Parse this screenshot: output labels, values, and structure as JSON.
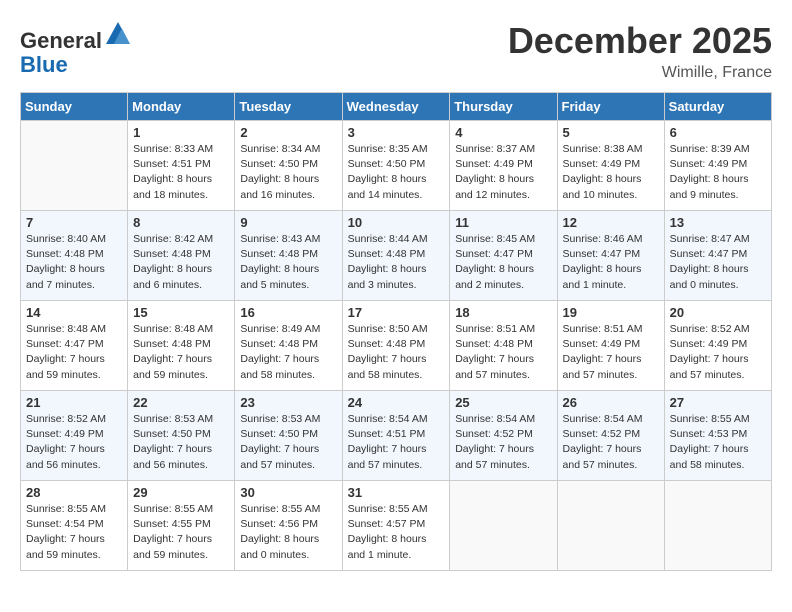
{
  "header": {
    "logo_general": "General",
    "logo_blue": "Blue",
    "month": "December 2025",
    "location": "Wimille, France"
  },
  "days_of_week": [
    "Sunday",
    "Monday",
    "Tuesday",
    "Wednesday",
    "Thursday",
    "Friday",
    "Saturday"
  ],
  "weeks": [
    [
      {
        "day": "",
        "info": ""
      },
      {
        "day": "1",
        "info": "Sunrise: 8:33 AM\nSunset: 4:51 PM\nDaylight: 8 hours\nand 18 minutes."
      },
      {
        "day": "2",
        "info": "Sunrise: 8:34 AM\nSunset: 4:50 PM\nDaylight: 8 hours\nand 16 minutes."
      },
      {
        "day": "3",
        "info": "Sunrise: 8:35 AM\nSunset: 4:50 PM\nDaylight: 8 hours\nand 14 minutes."
      },
      {
        "day": "4",
        "info": "Sunrise: 8:37 AM\nSunset: 4:49 PM\nDaylight: 8 hours\nand 12 minutes."
      },
      {
        "day": "5",
        "info": "Sunrise: 8:38 AM\nSunset: 4:49 PM\nDaylight: 8 hours\nand 10 minutes."
      },
      {
        "day": "6",
        "info": "Sunrise: 8:39 AM\nSunset: 4:49 PM\nDaylight: 8 hours\nand 9 minutes."
      }
    ],
    [
      {
        "day": "7",
        "info": "Sunrise: 8:40 AM\nSunset: 4:48 PM\nDaylight: 8 hours\nand 7 minutes."
      },
      {
        "day": "8",
        "info": "Sunrise: 8:42 AM\nSunset: 4:48 PM\nDaylight: 8 hours\nand 6 minutes."
      },
      {
        "day": "9",
        "info": "Sunrise: 8:43 AM\nSunset: 4:48 PM\nDaylight: 8 hours\nand 5 minutes."
      },
      {
        "day": "10",
        "info": "Sunrise: 8:44 AM\nSunset: 4:48 PM\nDaylight: 8 hours\nand 3 minutes."
      },
      {
        "day": "11",
        "info": "Sunrise: 8:45 AM\nSunset: 4:47 PM\nDaylight: 8 hours\nand 2 minutes."
      },
      {
        "day": "12",
        "info": "Sunrise: 8:46 AM\nSunset: 4:47 PM\nDaylight: 8 hours\nand 1 minute."
      },
      {
        "day": "13",
        "info": "Sunrise: 8:47 AM\nSunset: 4:47 PM\nDaylight: 8 hours\nand 0 minutes."
      }
    ],
    [
      {
        "day": "14",
        "info": "Sunrise: 8:48 AM\nSunset: 4:47 PM\nDaylight: 7 hours\nand 59 minutes."
      },
      {
        "day": "15",
        "info": "Sunrise: 8:48 AM\nSunset: 4:48 PM\nDaylight: 7 hours\nand 59 minutes."
      },
      {
        "day": "16",
        "info": "Sunrise: 8:49 AM\nSunset: 4:48 PM\nDaylight: 7 hours\nand 58 minutes."
      },
      {
        "day": "17",
        "info": "Sunrise: 8:50 AM\nSunset: 4:48 PM\nDaylight: 7 hours\nand 58 minutes."
      },
      {
        "day": "18",
        "info": "Sunrise: 8:51 AM\nSunset: 4:48 PM\nDaylight: 7 hours\nand 57 minutes."
      },
      {
        "day": "19",
        "info": "Sunrise: 8:51 AM\nSunset: 4:49 PM\nDaylight: 7 hours\nand 57 minutes."
      },
      {
        "day": "20",
        "info": "Sunrise: 8:52 AM\nSunset: 4:49 PM\nDaylight: 7 hours\nand 57 minutes."
      }
    ],
    [
      {
        "day": "21",
        "info": "Sunrise: 8:52 AM\nSunset: 4:49 PM\nDaylight: 7 hours\nand 56 minutes."
      },
      {
        "day": "22",
        "info": "Sunrise: 8:53 AM\nSunset: 4:50 PM\nDaylight: 7 hours\nand 56 minutes."
      },
      {
        "day": "23",
        "info": "Sunrise: 8:53 AM\nSunset: 4:50 PM\nDaylight: 7 hours\nand 57 minutes."
      },
      {
        "day": "24",
        "info": "Sunrise: 8:54 AM\nSunset: 4:51 PM\nDaylight: 7 hours\nand 57 minutes."
      },
      {
        "day": "25",
        "info": "Sunrise: 8:54 AM\nSunset: 4:52 PM\nDaylight: 7 hours\nand 57 minutes."
      },
      {
        "day": "26",
        "info": "Sunrise: 8:54 AM\nSunset: 4:52 PM\nDaylight: 7 hours\nand 57 minutes."
      },
      {
        "day": "27",
        "info": "Sunrise: 8:55 AM\nSunset: 4:53 PM\nDaylight: 7 hours\nand 58 minutes."
      }
    ],
    [
      {
        "day": "28",
        "info": "Sunrise: 8:55 AM\nSunset: 4:54 PM\nDaylight: 7 hours\nand 59 minutes."
      },
      {
        "day": "29",
        "info": "Sunrise: 8:55 AM\nSunset: 4:55 PM\nDaylight: 7 hours\nand 59 minutes."
      },
      {
        "day": "30",
        "info": "Sunrise: 8:55 AM\nSunset: 4:56 PM\nDaylight: 8 hours\nand 0 minutes."
      },
      {
        "day": "31",
        "info": "Sunrise: 8:55 AM\nSunset: 4:57 PM\nDaylight: 8 hours\nand 1 minute."
      },
      {
        "day": "",
        "info": ""
      },
      {
        "day": "",
        "info": ""
      },
      {
        "day": "",
        "info": ""
      }
    ]
  ]
}
